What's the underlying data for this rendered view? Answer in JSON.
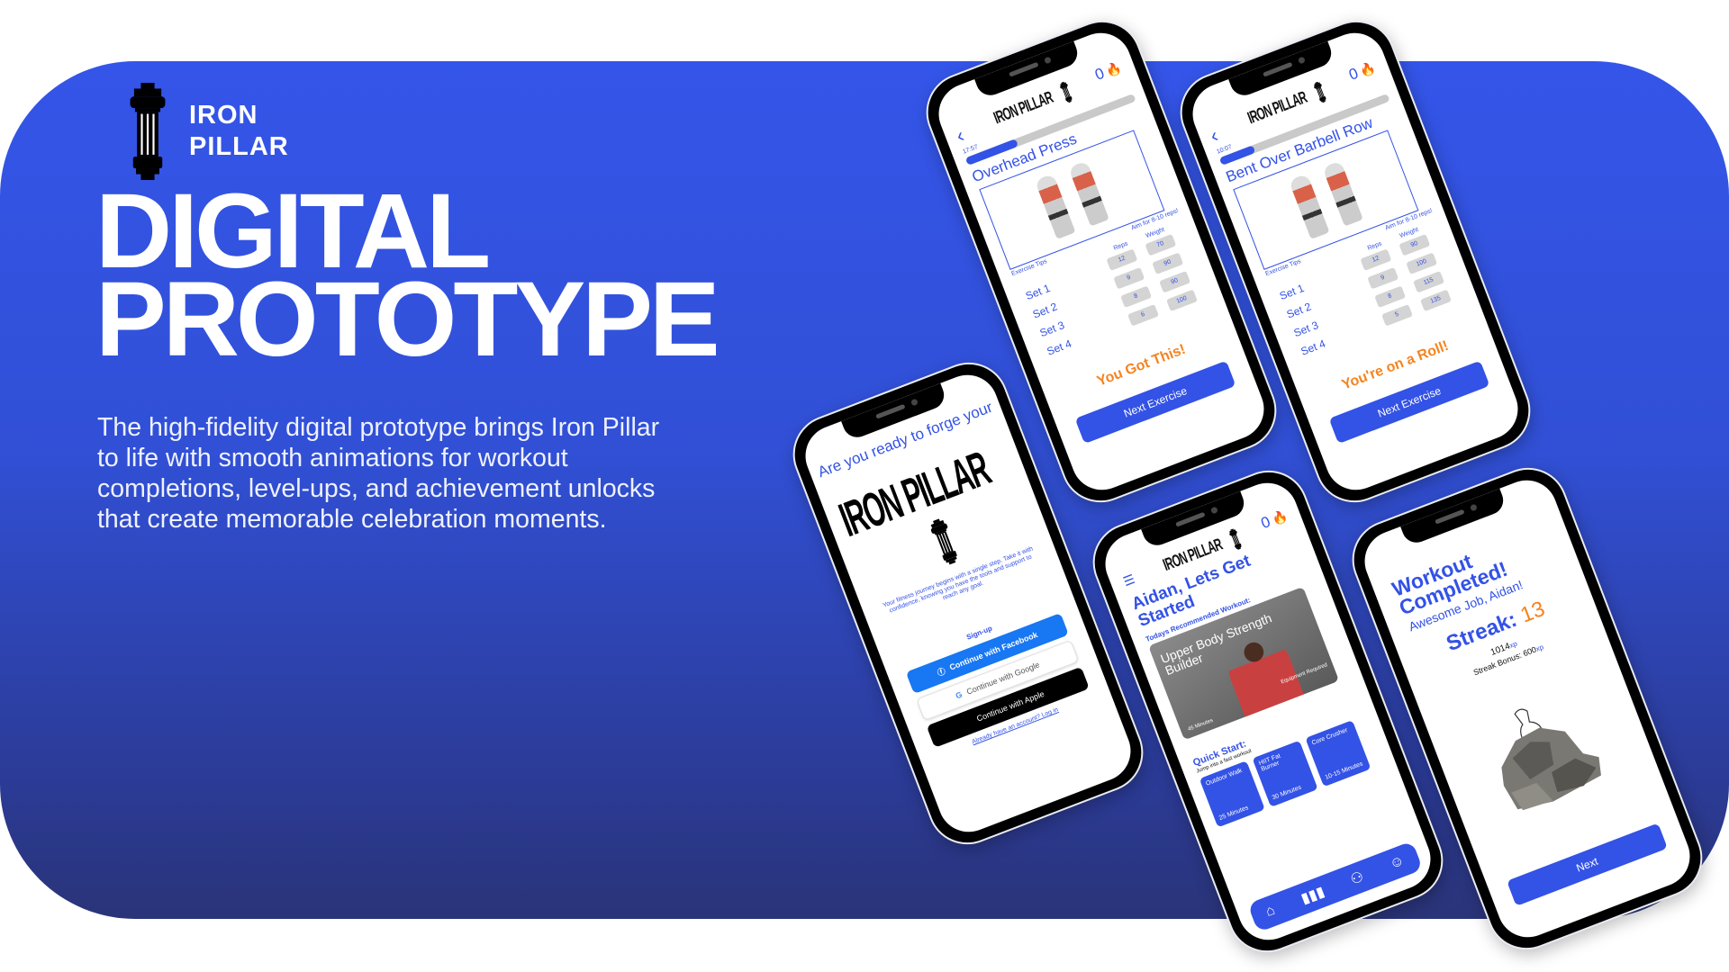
{
  "brand": {
    "name_line1": "IRON",
    "name_line2": "PILLAR"
  },
  "title": {
    "line1": "DIGITAL",
    "line2": "PROTOTYPE"
  },
  "description": "The high-fidelity digital prototype brings Iron Pillar to life with smooth animations for workout completions, level-ups, and achievement unlocks that create memorable celebration moments.",
  "colors": {
    "brand_blue": "#3352e6",
    "accent_orange": "#f5841f"
  },
  "app_logo": "IRON PILLAR",
  "streak_count": "0",
  "workout_screens": [
    {
      "timer": "17:57",
      "progress": 0.3,
      "exercise": "Overhead Press",
      "tips": "Exercise Tips",
      "aim": "Aim for 8-10 reps!",
      "reps_header": "Reps",
      "weight_header": "Weight",
      "sets": [
        {
          "label": "Set 1",
          "reps": "12",
          "weight": "70"
        },
        {
          "label": "Set 2",
          "reps": "9",
          "weight": "90"
        },
        {
          "label": "Set 3",
          "reps": "8",
          "weight": "90"
        },
        {
          "label": "Set 4",
          "reps": "6",
          "weight": "100"
        }
      ],
      "cheer": "You Got This!",
      "button": "Next Exercise"
    },
    {
      "timer": "10:07",
      "progress": 0.2,
      "exercise": "Bent Over Barbell Row",
      "tips": "Exercise Tips",
      "aim": "Aim for 8-10 reps!",
      "reps_header": "Reps",
      "weight_header": "Weight",
      "sets": [
        {
          "label": "Set 1",
          "reps": "12",
          "weight": "90"
        },
        {
          "label": "Set 2",
          "reps": "9",
          "weight": "100"
        },
        {
          "label": "Set 3",
          "reps": "8",
          "weight": "115"
        },
        {
          "label": "Set 4",
          "reps": "5",
          "weight": "135"
        }
      ],
      "cheer": "You're on a Roll!",
      "button": "Next Exercise"
    }
  ],
  "signup": {
    "question": "Are you ready to forge your",
    "logo": "IRON PILLAR",
    "paragraph": "Your fitness journey begins with a single step. Take it with confidence, knowing you have the tools and support to reach any goal.",
    "signup_label": "Sign-up",
    "facebook": "Continue with Facebook",
    "google": "Continue with Google",
    "apple": "Continue with Apple",
    "login_link": "Already have an account? Log in"
  },
  "home": {
    "greeting": "Aidan, Lets Get Started",
    "recommended_label": "Todays Recommended Workout:",
    "card": {
      "name": "Upper Body Strength Builder",
      "duration": "45 Minutes",
      "equipment": "Equipment Required"
    },
    "quick_start": "Quick Start:",
    "quick_sub": "Jump into a fast workout",
    "tiles": [
      {
        "name": "Outdoor Walk",
        "time": "25 Minutes"
      },
      {
        "name": "HIIT Fat Burner",
        "time": "30 Minutes"
      },
      {
        "name": "Core Crusher",
        "time": "10-15 Minutes"
      }
    ]
  },
  "completed": {
    "title": "Workout Completed!",
    "subtitle": "Awesome Job, Aidan!",
    "streak_label": "Streak:",
    "streak_value": "13",
    "xp": "1014",
    "xp_unit": "xp",
    "bonus_label": "Streak Bonus: 600",
    "button": "Next"
  }
}
